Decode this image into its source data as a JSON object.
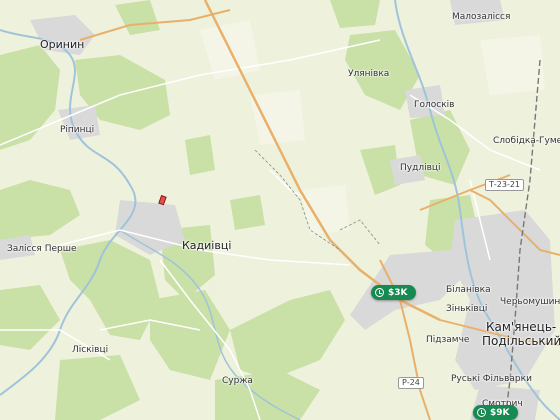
{
  "places": {
    "malozalissya": "Малозалісся",
    "oryniny": "Оринин",
    "ulianivka": "Улянівка",
    "holoskiv": "Голосків",
    "slobidka": "Слобідка-Гуменецька",
    "rypyntsi": "Рiпинцi",
    "pudlivtsi": "Пудлівці",
    "zalissya": "Залісся Перше",
    "kadyivtsi": "Кадиівці",
    "bilanivka": "Біланівка",
    "chornomushyn": "Черьомушин",
    "zinkivtsi": "Зіньківці",
    "kamianets_l1": "Кам'янець-",
    "kamianets_l2": "Подільський",
    "pidzamche": "Підзамче",
    "liskivtsi": "Лісківці",
    "ruski_filvarky": "Руські Фільварки",
    "surzha": "Суржа",
    "smotrych": "Смотрич"
  },
  "roads": {
    "t2321": "Т-23-21",
    "r24": "Р-24"
  },
  "price_pins": [
    {
      "label": "$3K",
      "icon": "clock-icon"
    },
    {
      "label": "$9K",
      "icon": "clock-icon"
    }
  ],
  "colors": {
    "land": "#eef2dc",
    "forest": "#c9e0a6",
    "urban": "#d9d9d9",
    "water": "#9fc4d9",
    "road_major": "#e8b06a",
    "pin": "#178a52"
  }
}
